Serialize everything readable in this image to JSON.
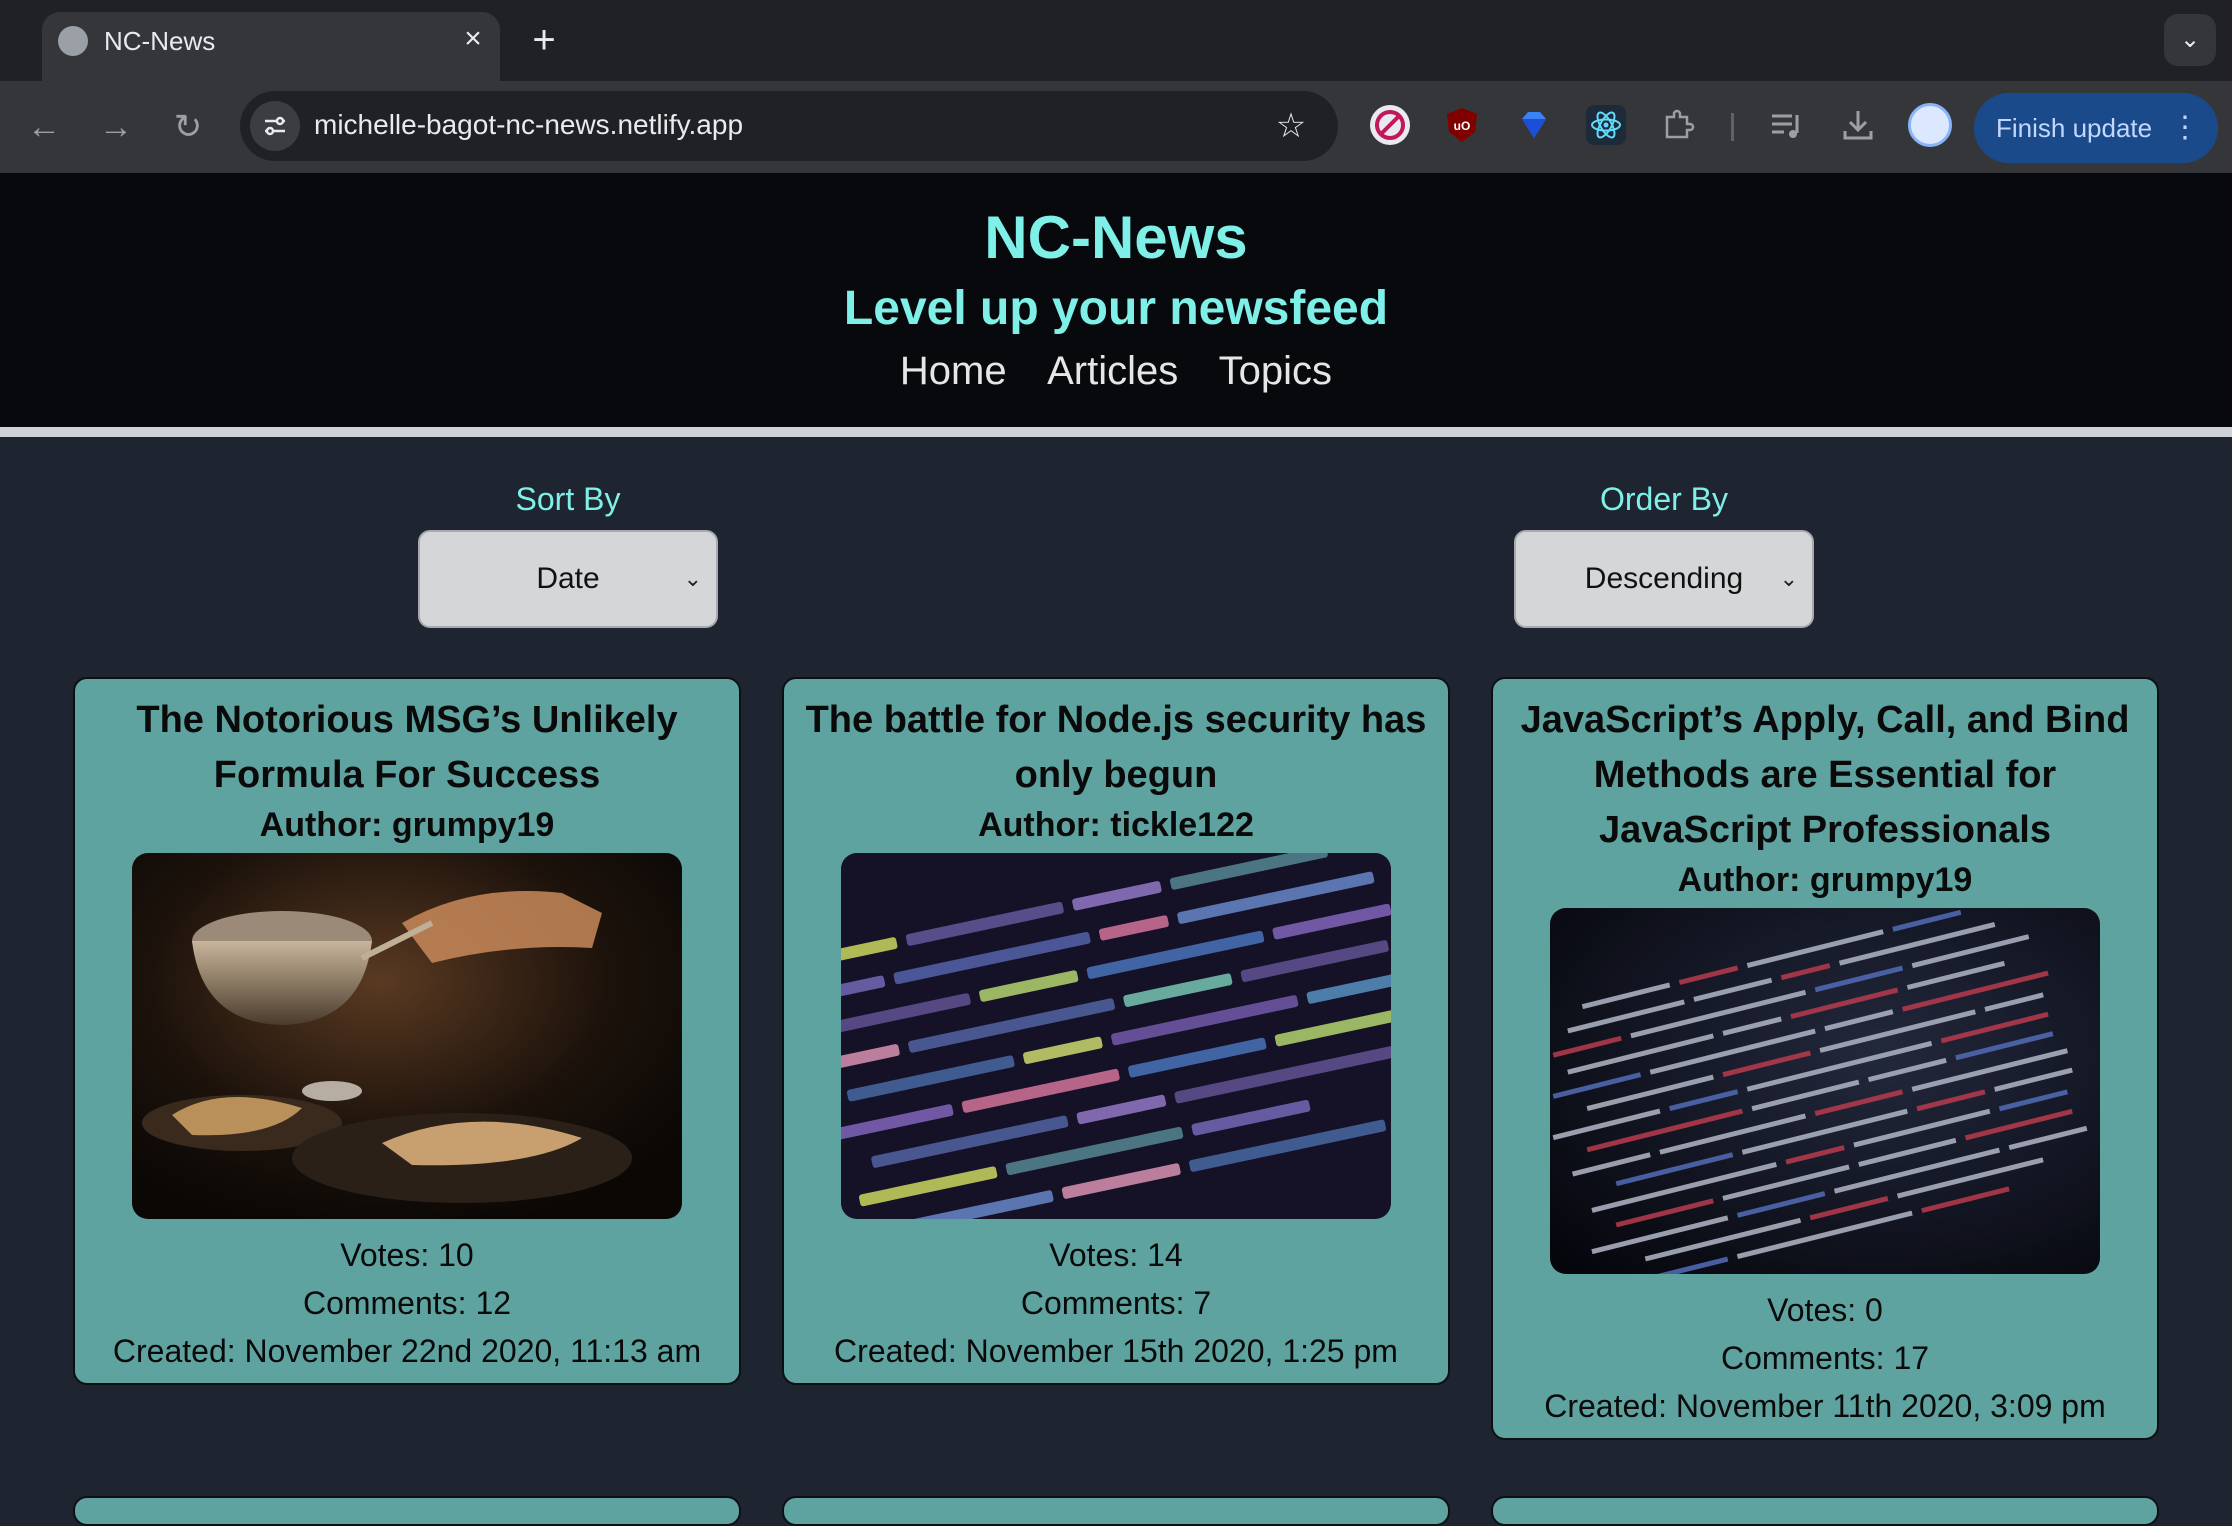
{
  "browser": {
    "tab_title": "NC-News",
    "url": "michelle-bagot-nc-news.netlify.app",
    "finish_update_label": "Finish update"
  },
  "site": {
    "title": "NC-News",
    "tagline": "Level up your newsfeed",
    "nav": [
      "Home",
      "Articles",
      "Topics"
    ]
  },
  "controls": {
    "sort_by": {
      "label": "Sort By",
      "value": "Date"
    },
    "order_by": {
      "label": "Order By",
      "value": "Descending"
    }
  },
  "articles": [
    {
      "title": "The Notorious MSG’s Unlikely Formula For Success",
      "author": "Author: grumpy19",
      "votes": "Votes: 10",
      "comments": "Comments: 12",
      "created": "Created: November 22nd 2020, 11:13 am"
    },
    {
      "title": "The battle for Node.js security has only begun",
      "author": "Author: tickle122",
      "votes": "Votes: 14",
      "comments": "Comments: 7",
      "created": "Created: November 15th 2020, 1:25 pm"
    },
    {
      "title": "JavaScript’s Apply, Call, and Bind Methods are Essential for JavaScript Professionals",
      "author": "Author: grumpy19",
      "votes": "Votes: 0",
      "comments": "Comments: 17",
      "created": "Created: November 11th 2020, 3:09 pm"
    }
  ],
  "colors": {
    "accent": "#7ff0e8",
    "card_bg": "#5fa3a0",
    "page_bg": "#1e2430",
    "header_bg": "#07090d"
  }
}
